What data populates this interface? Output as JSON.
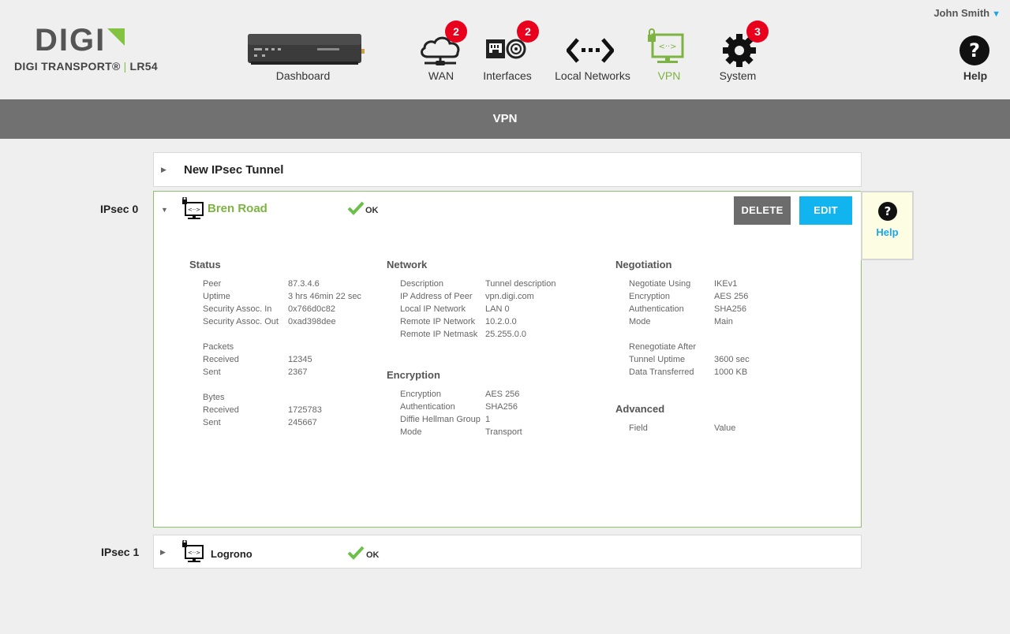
{
  "brand": {
    "logo": "DIGI",
    "product": "DIGI TRANSPORT®",
    "model": "LR54"
  },
  "user": {
    "name": "John Smith"
  },
  "nav": {
    "dashboard": {
      "label": "Dashboard"
    },
    "wan": {
      "label": "WAN",
      "badge": "2"
    },
    "interfaces": {
      "label": "Interfaces",
      "badge": "2"
    },
    "local_networks": {
      "label": "Local Networks"
    },
    "vpn": {
      "label": "VPN"
    },
    "system": {
      "label": "System",
      "badge": "3"
    },
    "help": {
      "label": "Help"
    }
  },
  "page": {
    "title": "VPN"
  },
  "new_tunnel": {
    "label": "New IPsec Tunnel"
  },
  "tunnels": [
    {
      "index_label": "IPsec 0",
      "name": "Bren Road",
      "status": "OK"
    },
    {
      "index_label": "IPsec 1",
      "name": "Logrono",
      "status": "OK"
    }
  ],
  "actions": {
    "delete": "DELETE",
    "edit": "EDIT"
  },
  "help_panel": {
    "label": "Help"
  },
  "details": {
    "status": {
      "title": "Status",
      "rows": [
        {
          "k": "Peer",
          "v": "87.3.4.6"
        },
        {
          "k": "Uptime",
          "v": "3 hrs 46min 22 sec"
        },
        {
          "k": "Security Assoc. In",
          "v": "0x766d0c82"
        },
        {
          "k": "Security Assoc. Out",
          "v": "0xad398dee"
        }
      ],
      "packets_label": "Packets",
      "packets": [
        {
          "k": "Received",
          "v": "12345"
        },
        {
          "k": "Sent",
          "v": "2367"
        }
      ],
      "bytes_label": "Bytes",
      "bytes": [
        {
          "k": "Received",
          "v": "1725783"
        },
        {
          "k": "Sent",
          "v": "245667"
        }
      ]
    },
    "network": {
      "title": "Network",
      "rows": [
        {
          "k": "Description",
          "v": "Tunnel description"
        },
        {
          "k": "IP Address of Peer",
          "v": "vpn.digi.com"
        },
        {
          "k": "Local IP Network",
          "v": "LAN 0"
        },
        {
          "k": "Remote IP Network",
          "v": "10.2.0.0"
        },
        {
          "k": "Remote IP Netmask",
          "v": "25.255.0.0"
        }
      ]
    },
    "encryption": {
      "title": "Encryption",
      "rows": [
        {
          "k": "Encryption",
          "v": "AES 256"
        },
        {
          "k": "Authentication",
          "v": "SHA256"
        },
        {
          "k": "Diffie Hellman Group",
          "v": "1"
        },
        {
          "k": "Mode",
          "v": "Transport"
        }
      ]
    },
    "negotiation": {
      "title": "Negotiation",
      "rows": [
        {
          "k": "Negotiate Using",
          "v": "IKEv1"
        },
        {
          "k": "Encryption",
          "v": "AES 256"
        },
        {
          "k": "Authentication",
          "v": "SHA256"
        },
        {
          "k": "Mode",
          "v": "Main"
        }
      ],
      "renegotiate_label": "Renegotiate After",
      "renegotiate": [
        {
          "k": "Tunnel Uptime",
          "v": "3600 sec"
        },
        {
          "k": "Data Transferred",
          "v": "1000 KB"
        }
      ]
    },
    "advanced": {
      "title": "Advanced",
      "rows": [
        {
          "k": "Field",
          "v": "Value"
        }
      ]
    }
  },
  "colors": {
    "accent_green": "#84c341",
    "accent_blue": "#12b4ef",
    "badge_red": "#e8001c",
    "ok_green": "#6cc04a"
  }
}
